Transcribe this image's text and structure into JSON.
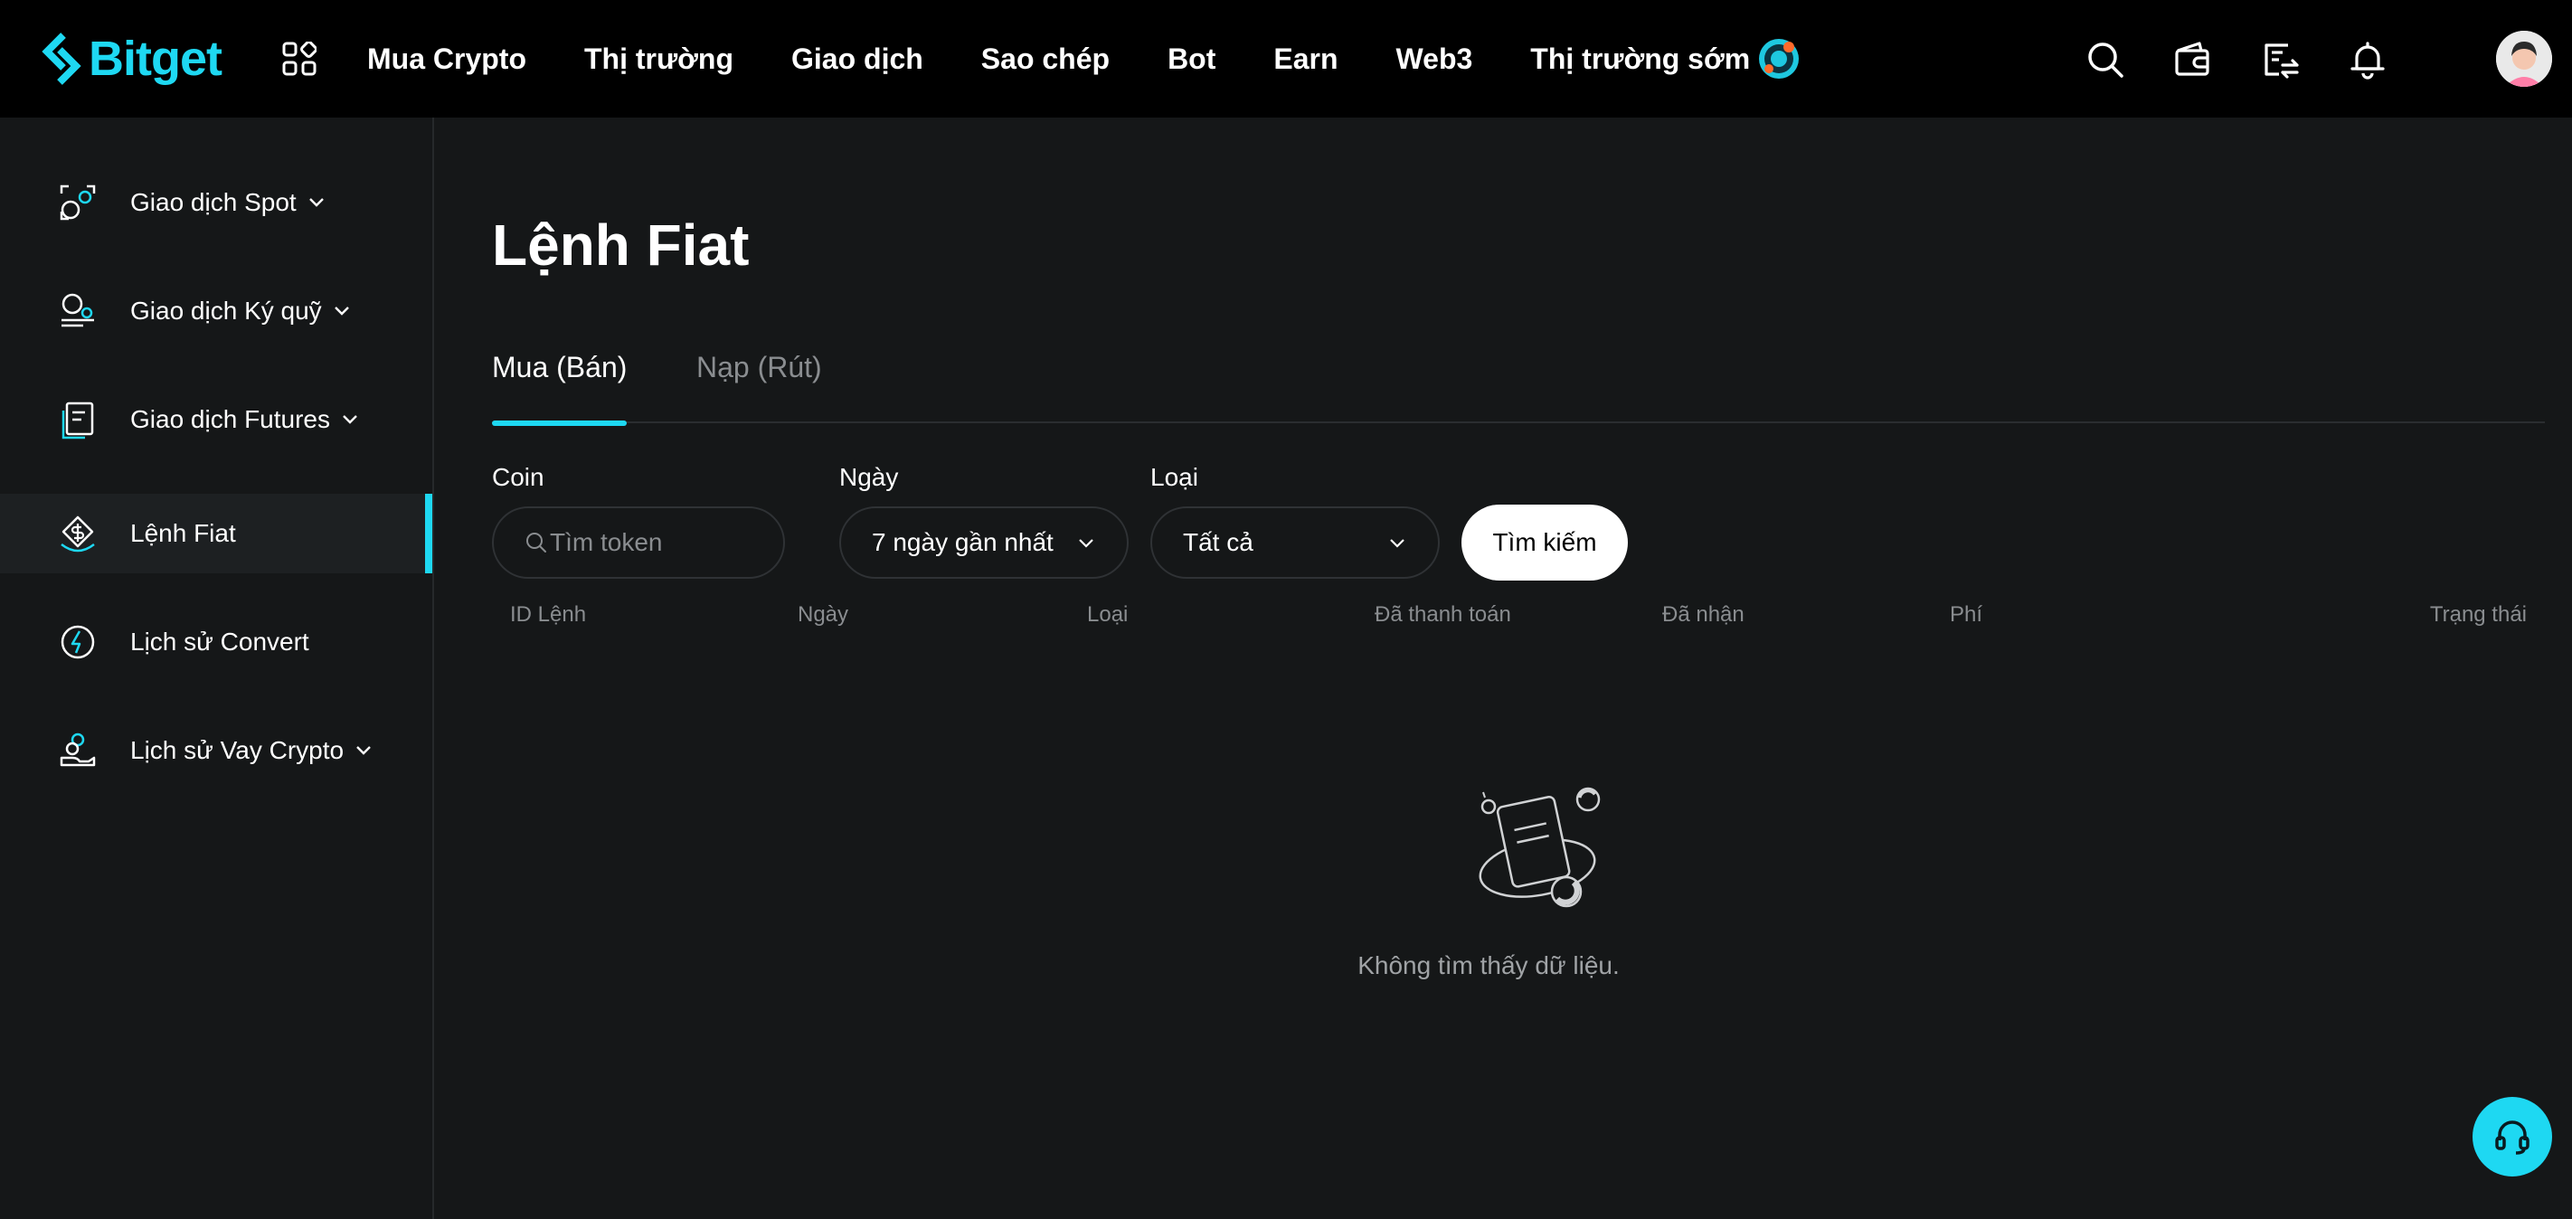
{
  "brand": {
    "name": "Bitget",
    "accent": "#1ed8f2"
  },
  "nav": {
    "items": [
      "Mua Crypto",
      "Thị trường",
      "Giao dịch",
      "Sao chép",
      "Bot",
      "Earn",
      "Web3",
      "Thị trường sớm"
    ]
  },
  "header_icons": [
    "search-icon",
    "wallet-icon",
    "orders-icon",
    "bell-icon",
    "avatar"
  ],
  "sidebar": {
    "items": [
      {
        "label": "Giao dịch Spot",
        "icon": "spot-icon",
        "expandable": true
      },
      {
        "label": "Giao dịch Ký quỹ",
        "icon": "margin-icon",
        "expandable": true
      },
      {
        "label": "Giao dịch Futures",
        "icon": "futures-icon",
        "expandable": true
      },
      {
        "label": "Lệnh Fiat",
        "icon": "fiat-icon",
        "expandable": false,
        "active": true
      },
      {
        "label": "Lịch sử Convert",
        "icon": "convert-icon",
        "expandable": false
      },
      {
        "label": "Lịch sử Vay Crypto",
        "icon": "loan-icon",
        "expandable": true
      }
    ]
  },
  "main": {
    "title": "Lệnh Fiat",
    "tabs": [
      {
        "label": "Mua (Bán)",
        "active": true
      },
      {
        "label": "Nạp (Rút)",
        "active": false
      }
    ],
    "filters": {
      "coin_label": "Coin",
      "coin_placeholder": "Tìm token",
      "date_label": "Ngày",
      "date_value": "7 ngày gần nhất",
      "type_label": "Loại",
      "type_value": "Tất cả",
      "search_button": "Tìm kiếm"
    },
    "columns": [
      "ID Lệnh",
      "Ngày",
      "Loại",
      "Đã thanh toán",
      "Đã nhận",
      "Phí",
      "Trạng thái"
    ],
    "empty_text": "Không tìm thấy dữ liệu."
  }
}
